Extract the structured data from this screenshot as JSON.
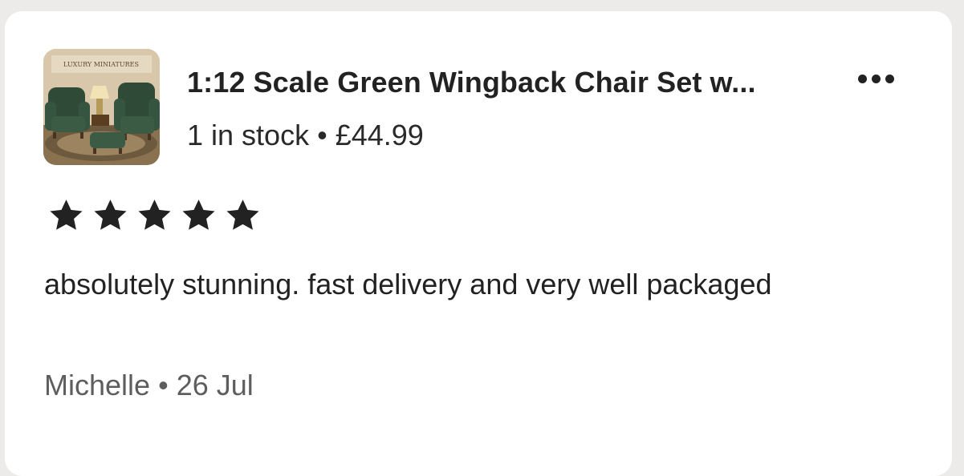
{
  "listing": {
    "thumbnail_icon": "product-photo-wingback-chairs",
    "thumbnail_caption": "LUXURY MINIATURES",
    "title": "1:12 Scale Green Wingback Chair Set w...",
    "stock": "1 in stock",
    "separator": "•",
    "price": "£44.99",
    "more_icon": "more-options-icon"
  },
  "review": {
    "rating": 5,
    "rating_max": 5,
    "star_icon": "star-icon",
    "text": "absolutely stunning. fast delivery and very well packaged",
    "author": "Michelle",
    "separator": "•",
    "date": "26 Jul"
  },
  "colors": {
    "page_background": "#ecebea",
    "card_background": "#ffffff",
    "text_primary": "#222222",
    "text_secondary": "#5e5e5e",
    "star_fill": "#222222"
  }
}
